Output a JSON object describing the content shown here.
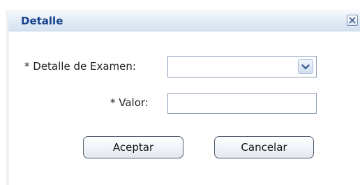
{
  "dialog": {
    "title": "Detalle",
    "close_icon": "close-icon"
  },
  "form": {
    "detalle_label": "* Detalle de Examen:",
    "detalle_value": "",
    "valor_label": "* Valor:",
    "valor_value": "",
    "dropdown_icon": "chevron-down-icon"
  },
  "buttons": {
    "accept_label": "Aceptar",
    "cancel_label": "Cancelar"
  },
  "colors": {
    "title_text": "#15428b",
    "titlebar_bg": "#dfe8f5",
    "field_border": "#8e9fb8"
  }
}
